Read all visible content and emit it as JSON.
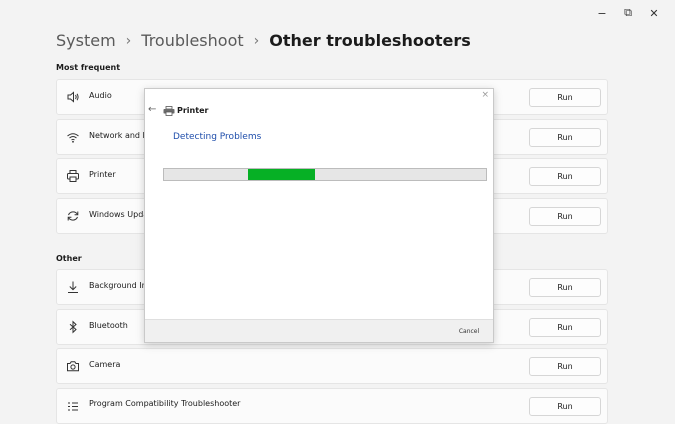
{
  "window_controls": {
    "minimize": "−",
    "maximize": "⧉",
    "close": "✕"
  },
  "breadcrumb": {
    "item1": "System",
    "item2": "Troubleshoot",
    "current": "Other troubleshooters",
    "separator": "›"
  },
  "sections": {
    "most_frequent": "Most frequent",
    "other": "Other"
  },
  "rows": [
    {
      "label": "Audio",
      "icon": "speaker-icon",
      "run": "Run"
    },
    {
      "label": "Network and Int",
      "icon": "wifi-icon",
      "run": "Run"
    },
    {
      "label": "Printer",
      "icon": "printer-icon",
      "run": "Run"
    },
    {
      "label": "Windows Update",
      "icon": "refresh-icon",
      "run": "Run"
    },
    {
      "label": "Background Inte",
      "icon": "download-icon",
      "run": "Run"
    },
    {
      "label": "Bluetooth",
      "icon": "bluetooth-icon",
      "run": "Run"
    },
    {
      "label": "Camera",
      "icon": "camera-icon",
      "run": "Run"
    },
    {
      "label": "Program Compatibility Troubleshooter",
      "icon": "list-icon",
      "run": "Run"
    }
  ],
  "dialog": {
    "close": "×",
    "back": "←",
    "title": "Printer",
    "status": "Detecting Problems",
    "progress": {
      "start_fraction": 0.26,
      "end_fraction": 0.47,
      "color": "#06b025"
    },
    "cancel": "Cancel"
  }
}
